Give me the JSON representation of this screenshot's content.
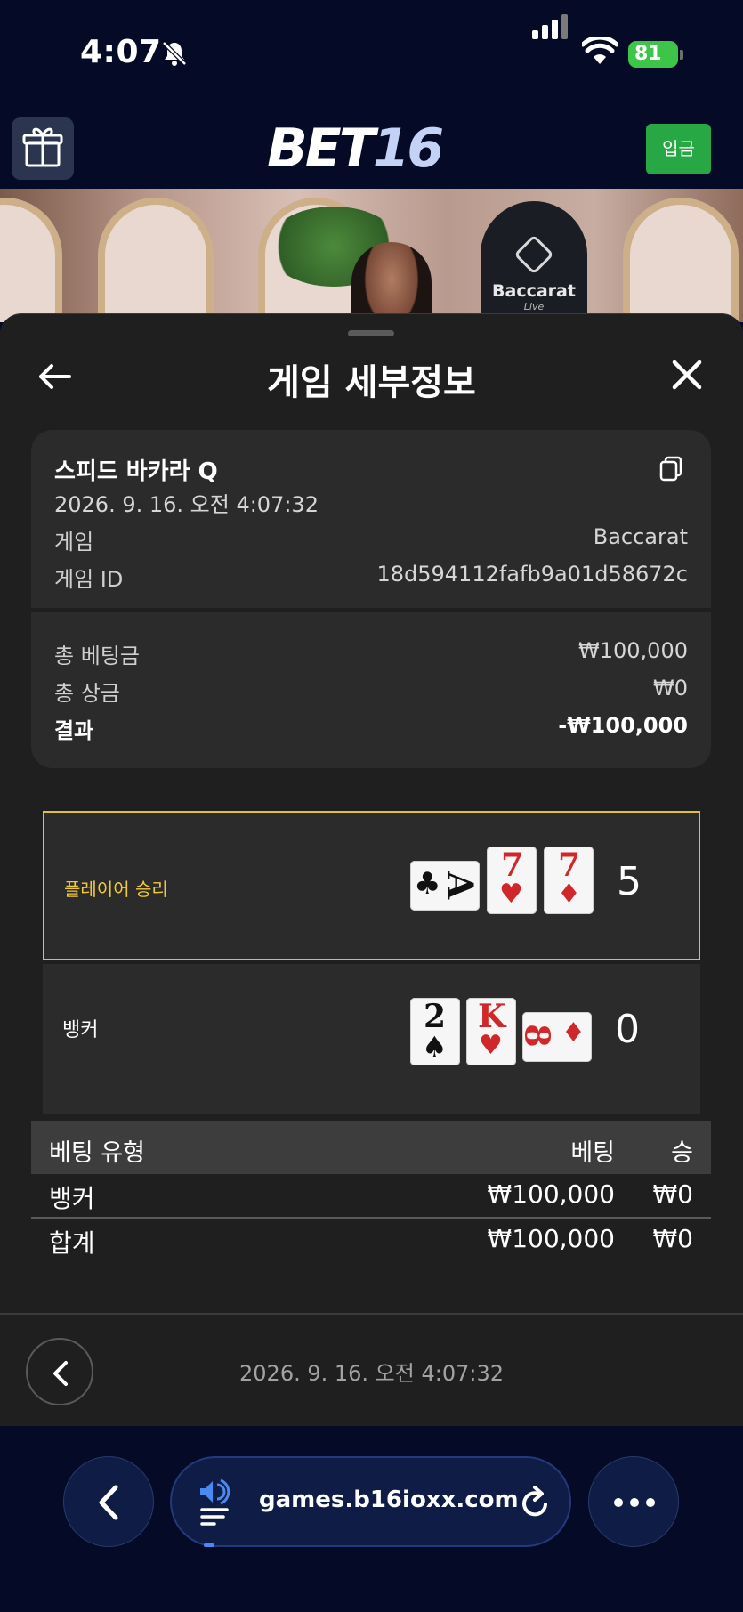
{
  "status_bar": {
    "time": "4:07",
    "battery": "81"
  },
  "header": {
    "logo_main": "BET",
    "logo_num": "16",
    "deposit_label": "입금"
  },
  "banner": {
    "badge_title": "Baccarat",
    "badge_sub": "Live"
  },
  "sheet": {
    "title": "게임 세부정보",
    "game_name": "스피드 바카라 Q",
    "game_datetime": "2026. 9. 16. 오전 4:07:32",
    "game_label": "게임",
    "game_value": "Baccarat",
    "game_id_label": "게임 ID",
    "game_id_value": "18d594112fafb9a01d58672c",
    "total_bet_label": "총 베팅금",
    "total_bet_value": "₩100,000",
    "total_prize_label": "총 상금",
    "total_prize_value": "₩0",
    "result_label": "결과",
    "result_value": "-₩100,000"
  },
  "results": {
    "player": {
      "label": "플레이어 승리",
      "score": "5",
      "cards": [
        {
          "rank": "A",
          "suit": "♣",
          "color": "#111111",
          "orientation": "sideways"
        },
        {
          "rank": "7",
          "suit": "♥",
          "color": "#d0282a",
          "orientation": "upright"
        },
        {
          "rank": "7",
          "suit": "♦",
          "color": "#d0282a",
          "orientation": "upright"
        }
      ]
    },
    "banker": {
      "label": "뱅커",
      "score": "0",
      "cards": [
        {
          "rank": "2",
          "suit": "♠",
          "color": "#111111",
          "orientation": "upright"
        },
        {
          "rank": "K",
          "suit": "♥",
          "color": "#d0282a",
          "orientation": "upright"
        },
        {
          "rank": "8",
          "suit": "♦",
          "color": "#d0282a",
          "orientation": "sideways"
        }
      ]
    }
  },
  "bet_table": {
    "headers": [
      "베팅 유형",
      "베팅",
      "승"
    ],
    "rows": [
      [
        "뱅커",
        "₩100,000",
        "₩0"
      ],
      [
        "합계",
        "₩100,000",
        "₩0"
      ]
    ]
  },
  "footer": {
    "datetime": "2026. 9. 16. 오전 4:07:32"
  },
  "browser": {
    "url": "games.b16ioxx.com"
  },
  "colors": {
    "win_border": "#e0c12f",
    "deposit": "#28a745",
    "sheet_bg": "#1f1f1f",
    "card_bg": "#2b2b2b"
  }
}
